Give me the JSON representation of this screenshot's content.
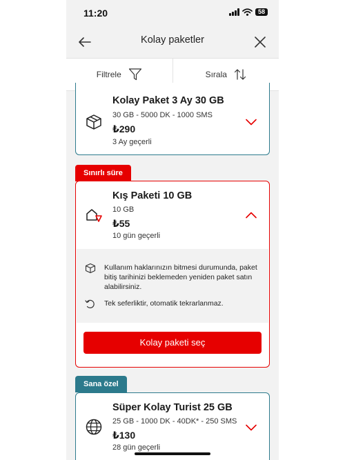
{
  "status_bar": {
    "time": "11:20",
    "battery": "58",
    "icons": [
      "signal-icon",
      "wifi-icon",
      "battery-icon"
    ]
  },
  "header": {
    "title": "Kolay paketler",
    "icons": [
      "back-arrow-icon",
      "close-icon"
    ]
  },
  "toolbar": {
    "filter_label": "Filtrele",
    "sort_label": "Sırala",
    "icons": [
      "filter-funnel-icon",
      "sort-arrows-icon"
    ]
  },
  "packages": [
    {
      "name": "Kolay Paket 3 Ay 30 GB",
      "details": "30 GB - 5000 DK - 1000 SMS",
      "price": "₺290",
      "validity": "3 Ay geçerli",
      "icon": "box-icon",
      "expanded": false
    },
    {
      "badge": "Sınırlı süre",
      "name": "Kış Paketi 10 GB",
      "details": "10 GB",
      "price": "₺55",
      "validity": "10 gün geçerli",
      "icon": "snow-house-icon",
      "expanded": true,
      "info": [
        {
          "icon": "box-small-icon",
          "text": "Kullanım haklarınızın bitmesi durumunda, paket bitiş tarihinizi beklemeden yeniden paket satın alabilirsiniz."
        },
        {
          "icon": "renew-icon",
          "text": "Tek seferliktir, otomatik tekrarlanmaz."
        }
      ],
      "cta": "Kolay paketi seç"
    },
    {
      "badge": "Sana özel",
      "name": "Süper Kolay Turist 25 GB",
      "details": "25 GB - 1000 DK - 40DK* - 250 SMS",
      "price": "₺130",
      "validity": "28 gün geçerli",
      "icon": "globe-icon",
      "expanded": false
    }
  ],
  "colors": {
    "accent": "#e60000",
    "teal": "#2c7a8c",
    "background": "#f2f2f2"
  }
}
